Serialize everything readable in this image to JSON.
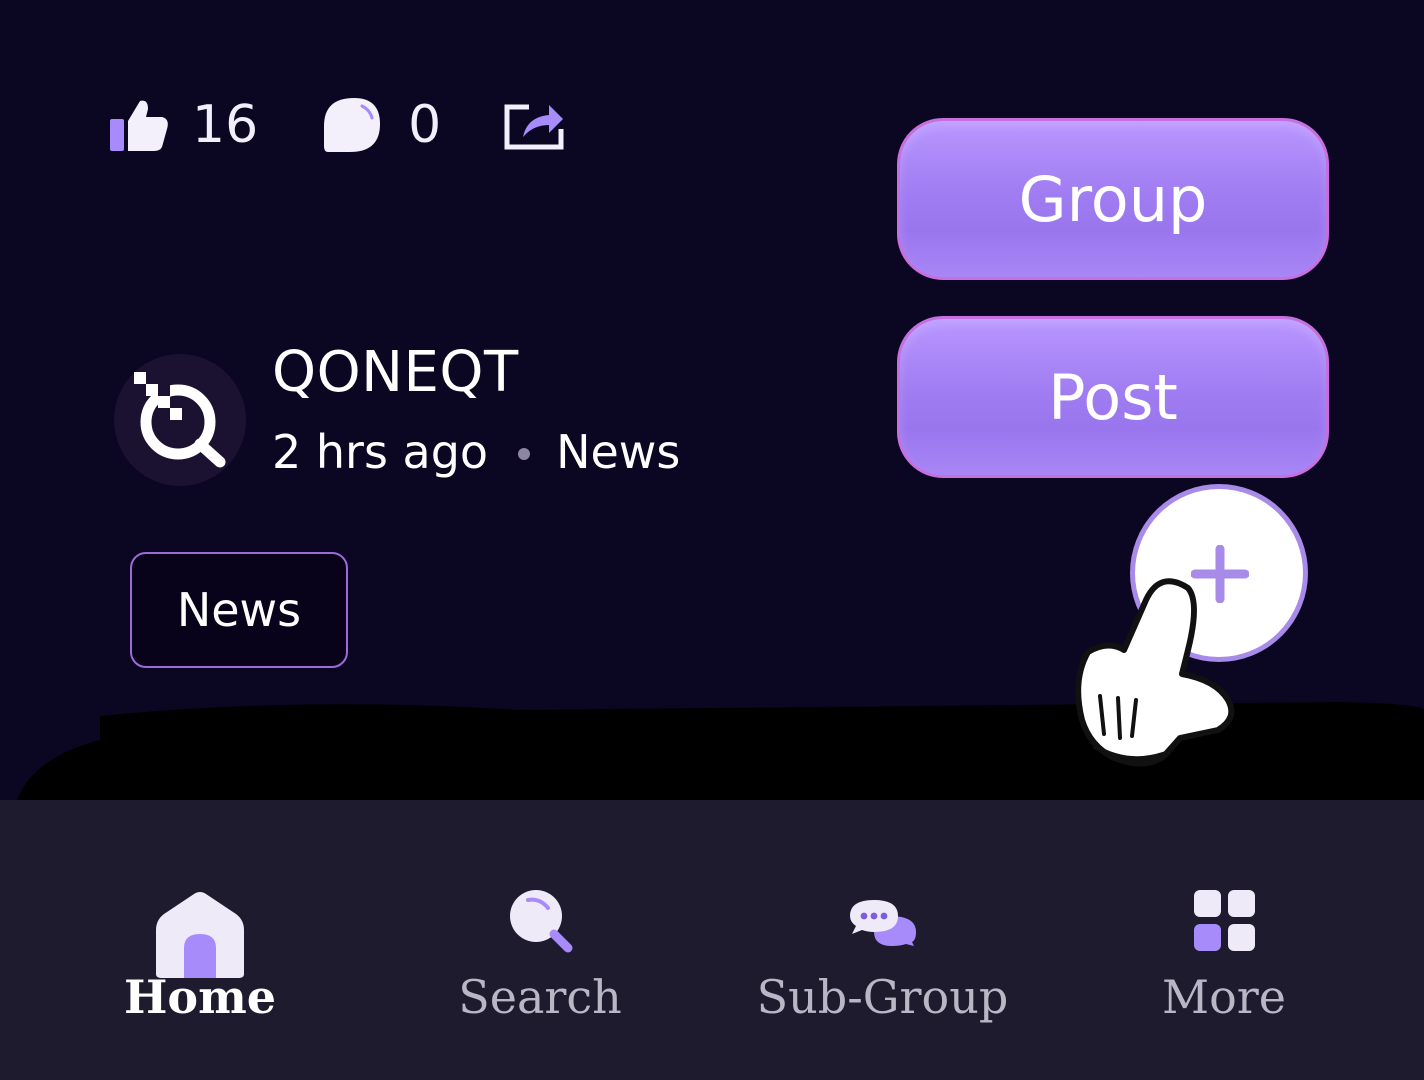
{
  "post": {
    "likes": "16",
    "comments": "0",
    "author": "QONEQT",
    "time": "2 hrs ago",
    "category": "News",
    "tag": "News"
  },
  "fab_menu": {
    "group_label": "Group",
    "post_label": "Post"
  },
  "nav": {
    "items": [
      {
        "label": "Home",
        "icon": "home-icon",
        "active": true
      },
      {
        "label": "Search",
        "icon": "search-icon",
        "active": false
      },
      {
        "label": "Sub-Group",
        "icon": "chat-bubbles-icon",
        "active": false
      },
      {
        "label": "More",
        "icon": "grid-icon",
        "active": false
      }
    ]
  },
  "colors": {
    "background": "#0b0622",
    "accent": "#9f7cf1",
    "nav_background": "#1e1b2e"
  }
}
